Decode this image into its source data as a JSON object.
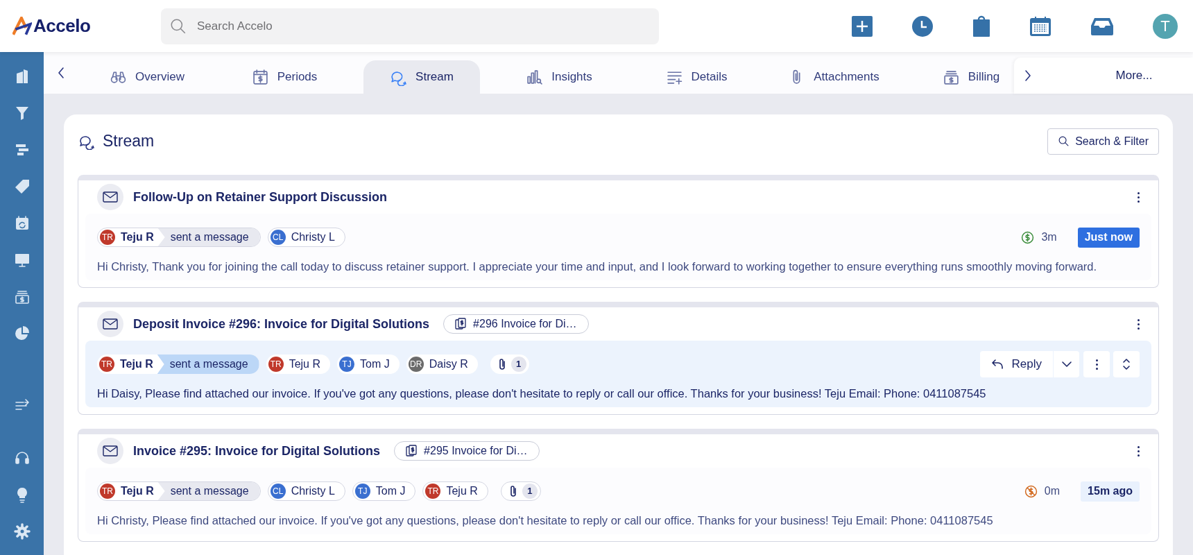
{
  "app": {
    "logo": "Accelo",
    "search": {
      "placeholder": "Search Accelo"
    },
    "avatar": "T"
  },
  "tabs": [
    {
      "label": "Overview",
      "selected": false
    },
    {
      "label": "Periods",
      "selected": false
    },
    {
      "label": "Stream",
      "selected": true
    },
    {
      "label": "Insights",
      "selected": false
    },
    {
      "label": "Details",
      "selected": false
    },
    {
      "label": "Attachments",
      "selected": false
    },
    {
      "label": "Billing",
      "selected": false
    }
  ],
  "more_tab": "More...",
  "stream": {
    "title": "Stream",
    "filter_button": "Search & Filter",
    "entries": [
      {
        "title": "Follow-Up on Retainer Support Discussion",
        "selected": false,
        "sender": {
          "initials": "TR",
          "name": "Teju R",
          "color": "#c0392b"
        },
        "action": "sent a message",
        "recipients": [
          {
            "initials": "CL",
            "name": "Christy L",
            "color": "#3a6fd0"
          }
        ],
        "time": {
          "billable": true,
          "duration": "3m"
        },
        "timestamp": {
          "text": "Just now",
          "highlighted": true
        },
        "message": "Hi Christy, Thank you for joining the call today to discuss retainer support. I appreciate your time and input, and I look forward to working together to ensure everything runs smoothly moving forward."
      },
      {
        "title": "Deposit Invoice #296: Invoice for Digital Solutions",
        "record": "#296 Invoice for Di…",
        "selected": true,
        "sender": {
          "initials": "TR",
          "name": "Teju R",
          "color": "#c0392b"
        },
        "action": "sent a message",
        "recipients": [
          {
            "initials": "TR",
            "name": "Teju R",
            "color": "#c0392b"
          },
          {
            "initials": "TJ",
            "name": "Tom J",
            "color": "#3a6fd0"
          },
          {
            "initials": "DR",
            "name": "Daisy R",
            "color": "#6b6b6b"
          }
        ],
        "attachments": "1",
        "reply_button": "Reply",
        "message": "Hi Daisy, Please find attached our invoice. If you've got any questions, please don't hesitate to reply or call our office. Thanks for your business! Teju Email: Phone: 0411087545"
      },
      {
        "title": "Invoice #295: Invoice for Digital Solutions",
        "record": "#295 Invoice for Di…",
        "selected": false,
        "sender": {
          "initials": "TR",
          "name": "Teju R",
          "color": "#c0392b"
        },
        "action": "sent a message",
        "recipients": [
          {
            "initials": "CL",
            "name": "Christy L",
            "color": "#3a6fd0"
          },
          {
            "initials": "TJ",
            "name": "Tom J",
            "color": "#3a6fd0"
          },
          {
            "initials": "TR",
            "name": "Teju R",
            "color": "#c0392b"
          }
        ],
        "attachments": "1",
        "time": {
          "billable": false,
          "duration": "0m"
        },
        "timestamp": {
          "text": "15m ago",
          "highlighted": false
        },
        "message": "Hi Christy, Please find attached our invoice. If you've got any questions, please don't hesitate to reply or call our office. Thanks for your business! Teju Email: Phone: 0411087545"
      }
    ]
  }
}
